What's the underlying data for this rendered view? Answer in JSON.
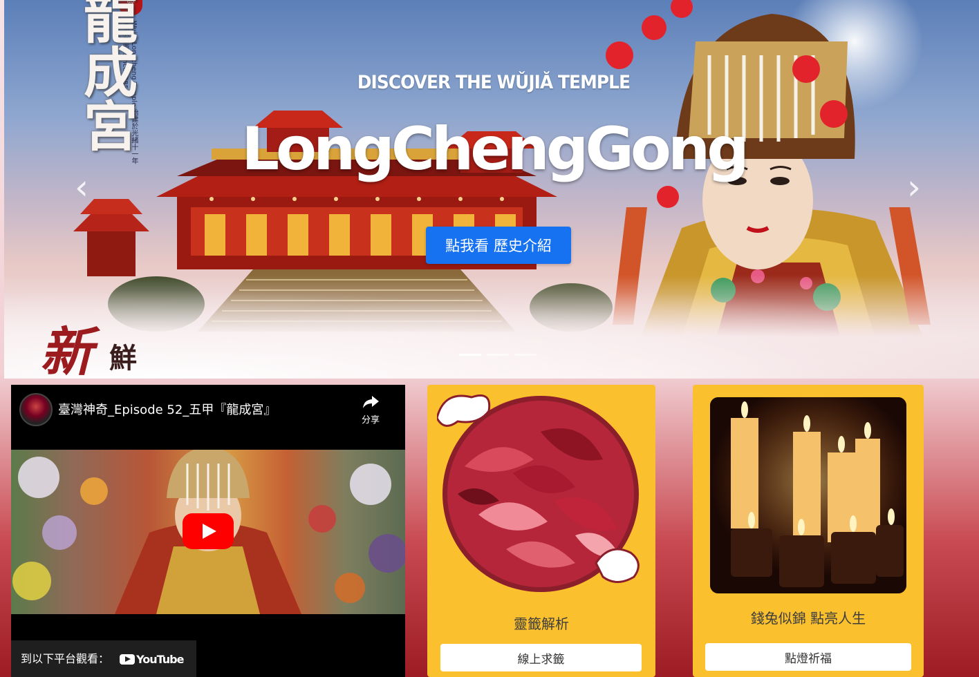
{
  "hero": {
    "brand_name": "龍成宮",
    "brand_subtitle": "Wujia Longcheng Temple 始建於光緒十一年·歲次乙酉 Since1885",
    "seal_text": "宮",
    "kicker": "DISCOVER THE WǓJIĂ TEMPLE",
    "title": "LongChengGong",
    "cta_label": "點我看 歷史介紹",
    "prev_label": "‹",
    "next_label": "›",
    "slides_count": 3,
    "active_slide": 0
  },
  "section_logo": {
    "text_big": "新",
    "text_small": "鮮"
  },
  "video": {
    "title": "臺灣神奇_Episode 52_五甲『龍成宮』",
    "share_label": "分享",
    "watch_on_label": "到以下平台觀看：",
    "platform_label": "YouTube"
  },
  "cards": [
    {
      "caption": "靈籤解析",
      "button_label": "線上求籤",
      "image_icon": "divination-blocks-icon"
    },
    {
      "caption": "錢兔似錦 點亮人生",
      "button_label": "點燈祈福",
      "image_icon": "candles-icon"
    }
  ],
  "colors": {
    "cta_blue": "#1672f0",
    "card_yellow": "#fbc02d",
    "youtube_red": "#ff0000",
    "deep_red": "#9d1c24"
  }
}
